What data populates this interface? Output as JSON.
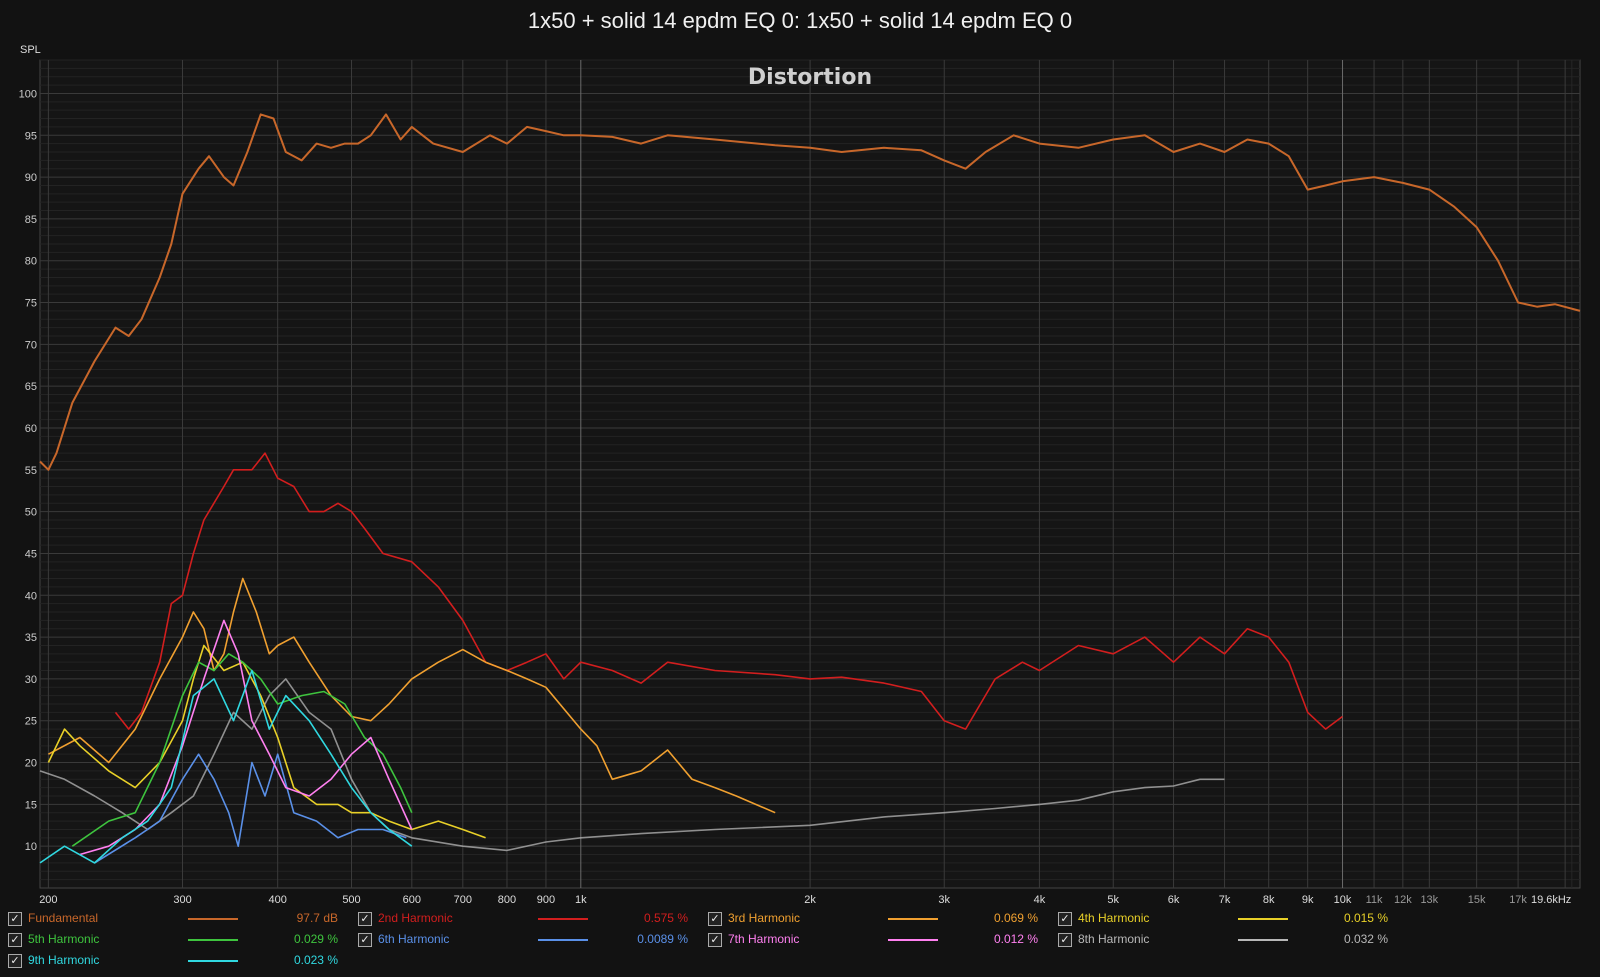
{
  "window_title": "1x50 + solid 14 epdm EQ 0: 1x50 + solid 14 epdm EQ 0",
  "chart_data": {
    "type": "line",
    "title": "Distortion",
    "ylabel": "SPL",
    "xlabel": "",
    "xscale": "log",
    "xlim": [
      195,
      20500
    ],
    "ylim": [
      5,
      104
    ],
    "grid": true,
    "x_ticks": [
      {
        "v": 200,
        "l": "200"
      },
      {
        "v": 300,
        "l": "300"
      },
      {
        "v": 400,
        "l": "400"
      },
      {
        "v": 500,
        "l": "500"
      },
      {
        "v": 600,
        "l": "600"
      },
      {
        "v": 700,
        "l": "700"
      },
      {
        "v": 800,
        "l": "800"
      },
      {
        "v": 900,
        "l": "900"
      },
      {
        "v": 1000,
        "l": "1k"
      },
      {
        "v": 2000,
        "l": "2k"
      },
      {
        "v": 3000,
        "l": "3k"
      },
      {
        "v": 4000,
        "l": "4k"
      },
      {
        "v": 5000,
        "l": "5k"
      },
      {
        "v": 6000,
        "l": "6k"
      },
      {
        "v": 7000,
        "l": "7k"
      },
      {
        "v": 8000,
        "l": "8k"
      },
      {
        "v": 9000,
        "l": "9k"
      },
      {
        "v": 10000,
        "l": "10k"
      },
      {
        "v": 11000,
        "l": "11k"
      },
      {
        "v": 12000,
        "l": "12k"
      },
      {
        "v": 13000,
        "l": "13k"
      },
      {
        "v": 15000,
        "l": "15k"
      },
      {
        "v": 17000,
        "l": "17k"
      },
      {
        "v": 19600,
        "l": "19.6kHz"
      }
    ],
    "y_ticks": [
      10,
      15,
      20,
      25,
      30,
      35,
      40,
      45,
      50,
      55,
      60,
      65,
      70,
      75,
      80,
      85,
      90,
      95,
      100
    ],
    "series": [
      {
        "name": "Fundamental",
        "color": "#c8672a",
        "value": "97.7 dB",
        "points": [
          [
            195,
            56
          ],
          [
            200,
            55
          ],
          [
            205,
            57
          ],
          [
            215,
            63
          ],
          [
            230,
            68
          ],
          [
            245,
            72
          ],
          [
            255,
            71
          ],
          [
            265,
            73
          ],
          [
            280,
            78
          ],
          [
            290,
            82
          ],
          [
            300,
            88
          ],
          [
            315,
            91
          ],
          [
            325,
            92.5
          ],
          [
            340,
            90
          ],
          [
            350,
            89
          ],
          [
            365,
            93
          ],
          [
            380,
            97.5
          ],
          [
            395,
            97
          ],
          [
            410,
            93
          ],
          [
            430,
            92
          ],
          [
            450,
            94
          ],
          [
            470,
            93.5
          ],
          [
            490,
            94
          ],
          [
            510,
            94
          ],
          [
            530,
            95
          ],
          [
            555,
            97.5
          ],
          [
            580,
            94.5
          ],
          [
            600,
            96
          ],
          [
            640,
            94
          ],
          [
            700,
            93
          ],
          [
            760,
            95
          ],
          [
            800,
            94
          ],
          [
            850,
            96
          ],
          [
            900,
            95.5
          ],
          [
            950,
            95
          ],
          [
            1000,
            95
          ],
          [
            1100,
            94.8
          ],
          [
            1200,
            94
          ],
          [
            1300,
            95
          ],
          [
            1500,
            94.5
          ],
          [
            1800,
            93.8
          ],
          [
            2000,
            93.5
          ],
          [
            2200,
            93
          ],
          [
            2500,
            93.5
          ],
          [
            2800,
            93.2
          ],
          [
            3000,
            92
          ],
          [
            3200,
            91
          ],
          [
            3400,
            93
          ],
          [
            3700,
            95
          ],
          [
            4000,
            94
          ],
          [
            4500,
            93.5
          ],
          [
            5000,
            94.5
          ],
          [
            5500,
            95
          ],
          [
            6000,
            93
          ],
          [
            6500,
            94
          ],
          [
            7000,
            93
          ],
          [
            7500,
            94.5
          ],
          [
            8000,
            94
          ],
          [
            8500,
            92.5
          ],
          [
            9000,
            88.5
          ],
          [
            9500,
            89
          ],
          [
            10000,
            89.5
          ],
          [
            11000,
            90
          ],
          [
            12000,
            89.3
          ],
          [
            13000,
            88.5
          ],
          [
            14000,
            86.5
          ],
          [
            15000,
            84
          ],
          [
            16000,
            80
          ],
          [
            17000,
            75
          ],
          [
            18000,
            74.5
          ],
          [
            19000,
            74.8
          ],
          [
            20500,
            74
          ]
        ]
      },
      {
        "name": "2nd Harmonic",
        "color": "#d21e1e",
        "value": "0.575 %",
        "points": [
          [
            245,
            26
          ],
          [
            255,
            24
          ],
          [
            265,
            26
          ],
          [
            280,
            32
          ],
          [
            290,
            39
          ],
          [
            300,
            40
          ],
          [
            310,
            45
          ],
          [
            320,
            49
          ],
          [
            340,
            53
          ],
          [
            350,
            55
          ],
          [
            370,
            55
          ],
          [
            385,
            57
          ],
          [
            400,
            54
          ],
          [
            420,
            53
          ],
          [
            440,
            50
          ],
          [
            460,
            50
          ],
          [
            480,
            51
          ],
          [
            500,
            50
          ],
          [
            520,
            48
          ],
          [
            550,
            45
          ],
          [
            600,
            44
          ],
          [
            650,
            41
          ],
          [
            700,
            37
          ],
          [
            750,
            32
          ],
          [
            800,
            31
          ],
          [
            850,
            32
          ],
          [
            900,
            33
          ],
          [
            950,
            30
          ],
          [
            1000,
            32
          ],
          [
            1100,
            31
          ],
          [
            1200,
            29.5
          ],
          [
            1300,
            32
          ],
          [
            1500,
            31
          ],
          [
            1800,
            30.5
          ],
          [
            2000,
            30
          ],
          [
            2200,
            30.2
          ],
          [
            2500,
            29.5
          ],
          [
            2800,
            28.5
          ],
          [
            3000,
            25
          ],
          [
            3200,
            24
          ],
          [
            3500,
            30
          ],
          [
            3800,
            32
          ],
          [
            4000,
            31
          ],
          [
            4500,
            34
          ],
          [
            5000,
            33
          ],
          [
            5500,
            35
          ],
          [
            6000,
            32
          ],
          [
            6500,
            35
          ],
          [
            7000,
            33
          ],
          [
            7500,
            36
          ],
          [
            8000,
            35
          ],
          [
            8500,
            32
          ],
          [
            9000,
            26
          ],
          [
            9500,
            24
          ],
          [
            10000,
            25.5
          ]
        ]
      },
      {
        "name": "3rd Harmonic",
        "color": "#f0a030",
        "value": "0.069 %",
        "points": [
          [
            200,
            21
          ],
          [
            220,
            23
          ],
          [
            240,
            20
          ],
          [
            260,
            24
          ],
          [
            280,
            30
          ],
          [
            300,
            35
          ],
          [
            310,
            38
          ],
          [
            320,
            36
          ],
          [
            330,
            31
          ],
          [
            340,
            33
          ],
          [
            350,
            38
          ],
          [
            360,
            42
          ],
          [
            375,
            38
          ],
          [
            390,
            33
          ],
          [
            400,
            34
          ],
          [
            420,
            35
          ],
          [
            440,
            32
          ],
          [
            470,
            28
          ],
          [
            500,
            25.5
          ],
          [
            530,
            25
          ],
          [
            560,
            27
          ],
          [
            600,
            30
          ],
          [
            650,
            32
          ],
          [
            700,
            33.5
          ],
          [
            750,
            32
          ],
          [
            800,
            31
          ],
          [
            850,
            30
          ],
          [
            900,
            29
          ],
          [
            1000,
            24
          ],
          [
            1050,
            22
          ],
          [
            1100,
            18
          ],
          [
            1200,
            19
          ],
          [
            1300,
            21.5
          ],
          [
            1400,
            18
          ],
          [
            1500,
            17
          ],
          [
            1600,
            16
          ],
          [
            1800,
            14
          ]
        ]
      },
      {
        "name": "4th Harmonic",
        "color": "#e8d028",
        "value": "0.015 %",
        "points": [
          [
            200,
            20
          ],
          [
            210,
            24
          ],
          [
            220,
            22
          ],
          [
            240,
            19
          ],
          [
            260,
            17
          ],
          [
            280,
            20
          ],
          [
            300,
            25
          ],
          [
            310,
            30
          ],
          [
            320,
            34
          ],
          [
            340,
            31
          ],
          [
            360,
            32
          ],
          [
            380,
            28
          ],
          [
            400,
            23
          ],
          [
            420,
            17
          ],
          [
            450,
            15
          ],
          [
            480,
            15
          ],
          [
            500,
            14
          ],
          [
            530,
            14
          ],
          [
            560,
            13
          ],
          [
            600,
            12
          ],
          [
            650,
            13
          ],
          [
            700,
            12
          ],
          [
            750,
            11
          ]
        ]
      },
      {
        "name": "5th Harmonic",
        "color": "#3ec43e",
        "value": "0.029 %",
        "points": [
          [
            215,
            10
          ],
          [
            240,
            13
          ],
          [
            260,
            14
          ],
          [
            280,
            20
          ],
          [
            300,
            28
          ],
          [
            315,
            32
          ],
          [
            330,
            31
          ],
          [
            345,
            33
          ],
          [
            360,
            32
          ],
          [
            380,
            30
          ],
          [
            400,
            27
          ],
          [
            430,
            28
          ],
          [
            460,
            28.5
          ],
          [
            490,
            27
          ],
          [
            520,
            23
          ],
          [
            550,
            21
          ],
          [
            580,
            17
          ],
          [
            600,
            14
          ]
        ]
      },
      {
        "name": "6th Harmonic",
        "color": "#5a90e8",
        "value": "0.0089 %",
        "points": [
          [
            230,
            8
          ],
          [
            260,
            11
          ],
          [
            280,
            13
          ],
          [
            300,
            18
          ],
          [
            315,
            21
          ],
          [
            330,
            18
          ],
          [
            345,
            14
          ],
          [
            355,
            10
          ],
          [
            370,
            20
          ],
          [
            385,
            16
          ],
          [
            400,
            21
          ],
          [
            420,
            14
          ],
          [
            450,
            13
          ],
          [
            480,
            11
          ],
          [
            510,
            12
          ],
          [
            550,
            12
          ],
          [
            590,
            11
          ]
        ]
      },
      {
        "name": "7th Harmonic",
        "color": "#ff80f0",
        "value": "0.012 %",
        "points": [
          [
            220,
            9
          ],
          [
            240,
            10
          ],
          [
            260,
            12
          ],
          [
            280,
            15
          ],
          [
            300,
            22
          ],
          [
            320,
            30
          ],
          [
            340,
            37
          ],
          [
            355,
            33
          ],
          [
            370,
            25
          ],
          [
            390,
            21
          ],
          [
            410,
            17
          ],
          [
            440,
            16
          ],
          [
            470,
            18
          ],
          [
            500,
            21
          ],
          [
            530,
            23
          ],
          [
            560,
            18
          ],
          [
            600,
            12
          ]
        ]
      },
      {
        "name": "8th Harmonic",
        "color": "#b8b8b8",
        "value": "0.032 %",
        "points": [
          [
            195,
            19
          ],
          [
            210,
            18
          ],
          [
            230,
            16
          ],
          [
            250,
            14
          ],
          [
            270,
            12
          ],
          [
            290,
            14
          ],
          [
            310,
            16
          ],
          [
            330,
            21
          ],
          [
            350,
            26
          ],
          [
            370,
            24
          ],
          [
            390,
            28
          ],
          [
            410,
            30
          ],
          [
            440,
            26
          ],
          [
            470,
            24
          ],
          [
            500,
            18
          ],
          [
            530,
            14
          ],
          [
            560,
            12
          ],
          [
            600,
            11
          ],
          [
            700,
            10
          ],
          [
            800,
            9.5
          ],
          [
            900,
            10.5
          ],
          [
            1000,
            11
          ],
          [
            1200,
            11.5
          ],
          [
            1500,
            12
          ],
          [
            2000,
            12.5
          ],
          [
            2500,
            13.5
          ],
          [
            3000,
            14
          ],
          [
            3500,
            14.5
          ],
          [
            4000,
            15
          ],
          [
            4500,
            15.5
          ],
          [
            5000,
            16.5
          ],
          [
            5500,
            17
          ],
          [
            6000,
            17.2
          ],
          [
            6500,
            18
          ],
          [
            7000,
            18
          ]
        ]
      },
      {
        "name": "9th Harmonic",
        "color": "#30d8e0",
        "value": "0.023 %",
        "points": [
          [
            195,
            8
          ],
          [
            210,
            10
          ],
          [
            230,
            8
          ],
          [
            250,
            11
          ],
          [
            270,
            13
          ],
          [
            290,
            17
          ],
          [
            310,
            28
          ],
          [
            330,
            30
          ],
          [
            350,
            25
          ],
          [
            370,
            31
          ],
          [
            390,
            24
          ],
          [
            410,
            28
          ],
          [
            440,
            25
          ],
          [
            470,
            21
          ],
          [
            500,
            17
          ],
          [
            530,
            14
          ],
          [
            560,
            12
          ],
          [
            600,
            10
          ]
        ]
      }
    ]
  }
}
